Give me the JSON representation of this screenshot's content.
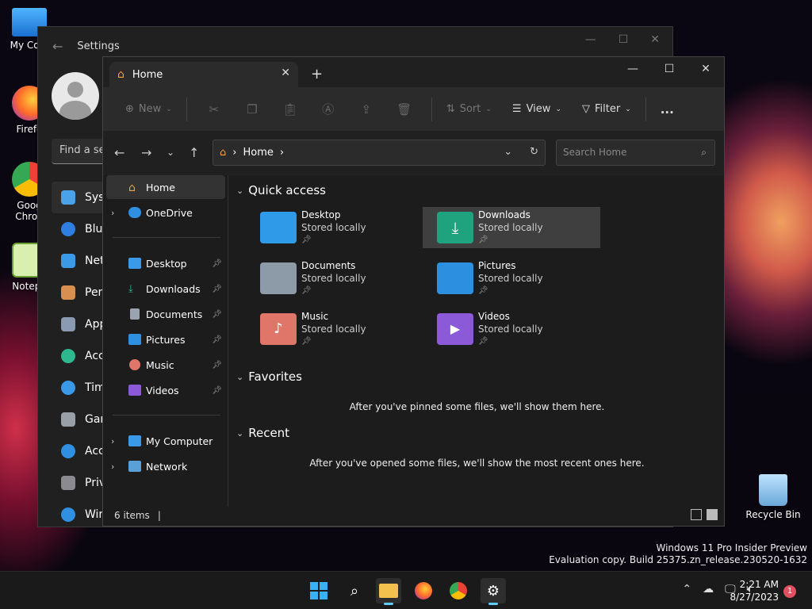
{
  "desktop": {
    "icons": [
      {
        "label": "My Com",
        "icon": "monitor-icon"
      },
      {
        "label": "Firefo",
        "icon": "firefox-icon"
      },
      {
        "label": "Goog Chron",
        "icon": "chrome-icon"
      },
      {
        "label": "Notepa",
        "icon": "notepad-icon"
      }
    ],
    "recycle_bin": "Recycle Bin",
    "watermark_line1": "Windows 11 Pro Insider Preview",
    "watermark_line2": "Evaluation copy. Build 25375.zn_release.230520-1632"
  },
  "settings": {
    "title": "Settings",
    "search_placeholder": "Find a se",
    "nav": [
      "Syst",
      "Blue",
      "Net",
      "Pers",
      "App",
      "Acc",
      "Tim",
      "Gar",
      "Acc",
      "Priv",
      "Win"
    ]
  },
  "explorer": {
    "tab_title": "Home",
    "new_tab": "+",
    "toolbar": {
      "new": "New",
      "sort": "Sort",
      "view": "View",
      "filter": "Filter",
      "more": "..."
    },
    "address": {
      "crumb": "Home",
      "search_placeholder": "Search Home"
    },
    "nav_pane": {
      "home": "Home",
      "onedrive": "OneDrive",
      "pinned": [
        "Desktop",
        "Downloads",
        "Documents",
        "Pictures",
        "Music",
        "Videos"
      ],
      "my_computer": "My Computer",
      "network": "Network"
    },
    "sections": {
      "quick_access": "Quick access",
      "favorites": "Favorites",
      "favorites_empty": "After you've pinned some files, we'll show them here.",
      "recent": "Recent",
      "recent_empty": "After you've opened some files, we'll show the most recent ones here."
    },
    "quick_access_items": [
      {
        "name": "Desktop",
        "status": "Stored locally",
        "color": "#2e9ae8"
      },
      {
        "name": "Downloads",
        "status": "Stored locally",
        "color": "#1fa37f"
      },
      {
        "name": "Documents",
        "status": "Stored locally",
        "color": "#8d9aa8"
      },
      {
        "name": "Pictures",
        "status": "Stored locally",
        "color": "#2c8fe0"
      },
      {
        "name": "Music",
        "status": "Stored locally",
        "color": "#e0766a"
      },
      {
        "name": "Videos",
        "status": "Stored locally",
        "color": "#8a5ad8"
      }
    ],
    "status": "6 items"
  },
  "taskbar": {
    "time": "2:21 AM",
    "date": "8/27/2023",
    "notification_count": "1"
  }
}
